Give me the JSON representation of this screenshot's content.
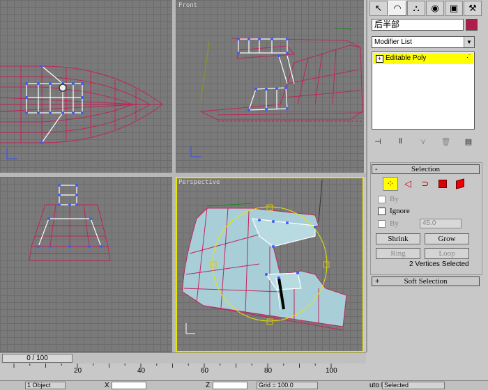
{
  "viewports": {
    "top": {
      "label": ""
    },
    "front": {
      "label": "Front"
    },
    "left": {
      "label": ""
    },
    "perspective": {
      "label": "Perspective"
    }
  },
  "panel": {
    "tabs": [
      {
        "name": "create-tab",
        "glyph": "↖"
      },
      {
        "name": "modify-tab",
        "glyph": "◠"
      },
      {
        "name": "hierarchy-tab",
        "glyph": "⛬"
      },
      {
        "name": "motion-tab",
        "glyph": "◉"
      },
      {
        "name": "display-tab",
        "glyph": "▣"
      },
      {
        "name": "utilities-tab",
        "glyph": "⚒"
      }
    ],
    "object_name": "后半部",
    "object_color": "#b01c4c",
    "modifier_list": "Modifier List",
    "stack_item": "Editable Poly",
    "selection_title": "Selection",
    "by_vertex": "By",
    "ignore": "Ignore",
    "by_angle": "By",
    "angle_value": "45.0",
    "shrink": "Shrink",
    "grow": "Grow",
    "ring": "Ring",
    "loop": "Loop",
    "selected_status": "2 Vertices Selected",
    "soft_selection_title": "Soft Selection"
  },
  "timeline": {
    "frame": "0 / 100",
    "ticks": [
      "20",
      "40",
      "60",
      "80",
      "100"
    ]
  },
  "statusbar": {
    "objects": "1 Object",
    "x_label": "X",
    "z_label": "Z",
    "grid": "Grid = 100.0",
    "key_mode": "uto Ke",
    "selected": "Selected"
  }
}
